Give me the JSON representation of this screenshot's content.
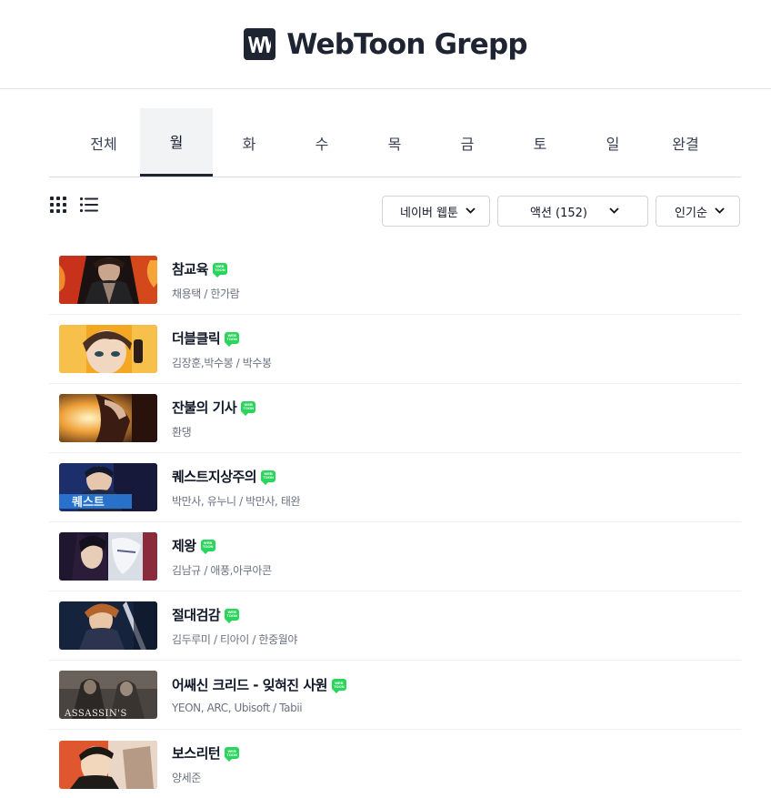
{
  "header": {
    "logo_text": "WebToon Grepp",
    "logo_icon": "webtoon-w-logo-icon"
  },
  "tabs": [
    {
      "label": "전체",
      "active": false
    },
    {
      "label": "월",
      "active": true
    },
    {
      "label": "화",
      "active": false
    },
    {
      "label": "수",
      "active": false
    },
    {
      "label": "목",
      "active": false
    },
    {
      "label": "금",
      "active": false
    },
    {
      "label": "토",
      "active": false
    },
    {
      "label": "일",
      "active": false
    },
    {
      "label": "완결",
      "active": false
    }
  ],
  "view_toggle": {
    "grid_icon": "grid-view-icon",
    "list_icon": "list-view-icon"
  },
  "filters": {
    "platform": "네이버 웹툰",
    "genre": "액션 (152)",
    "sort": "인기순"
  },
  "list": [
    {
      "title": "참교육",
      "author": "채용택 / 한가람",
      "badge": "WEB TOON"
    },
    {
      "title": "더블클릭",
      "author": "김장훈,박수봉 / 박수봉",
      "badge": "WEB TOON"
    },
    {
      "title": "잔불의 기사",
      "author": "환댕",
      "badge": "WEB TOON"
    },
    {
      "title": "퀘스트지상주의",
      "author": "박만사, 유누니 / 박만사, 태완",
      "badge": "WEB TOON"
    },
    {
      "title": "제왕",
      "author": "김남규 / 애풍,아쿠아콘",
      "badge": "WEB TOON"
    },
    {
      "title": "절대검감",
      "author": "김두루미 / 티아이 / 한중월야",
      "badge": "WEB TOON"
    },
    {
      "title": "어쌔신 크리드 - 잊혀진 사원",
      "author": "YEON, ARC, Ubisoft / Tabii",
      "badge": "WEB TOON"
    },
    {
      "title": "보스리턴",
      "author": "양세준",
      "badge": "WEB TOON"
    }
  ],
  "colors": {
    "brand": "#1f2433",
    "badge_green": "#2bd45d",
    "active_tab_bg": "#f2f3f5"
  }
}
